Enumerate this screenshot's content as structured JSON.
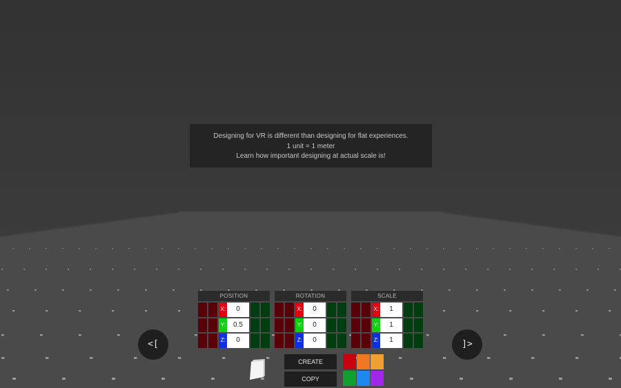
{
  "info": {
    "line1": "Designing for VR is different than designing for flat experiences.",
    "line2": "1 unit = 1 meter",
    "line3": "Learn how important designing at actual scale is!"
  },
  "panels": {
    "position": {
      "title": "POSITION",
      "x": "0",
      "y": "0.5",
      "z": "0"
    },
    "rotation": {
      "title": "ROTATION",
      "x": "0",
      "y": "0",
      "z": "0"
    },
    "scale": {
      "title": "SCALE",
      "x": "1",
      "y": "1",
      "z": "1"
    }
  },
  "axis_labels": {
    "x": "X:",
    "y": "Y:",
    "z": "Z:"
  },
  "nav": {
    "prev_label": "<[",
    "next_label": "]>"
  },
  "actions": {
    "create_label": "CREATE",
    "copy_label": "COPY"
  },
  "palette": {
    "colors": [
      "#c8000f",
      "#f07820",
      "#f0a030",
      "#10a030",
      "#1e88f0",
      "#a028e8"
    ]
  },
  "colors": {
    "sky": "#323232",
    "floor": "#4a4a4a",
    "panel_bg": "#242424",
    "axis_x": "#e00010",
    "axis_y": "#10d010",
    "axis_z": "#1030e0"
  },
  "icons": {
    "shape_preview": "cube-icon"
  }
}
